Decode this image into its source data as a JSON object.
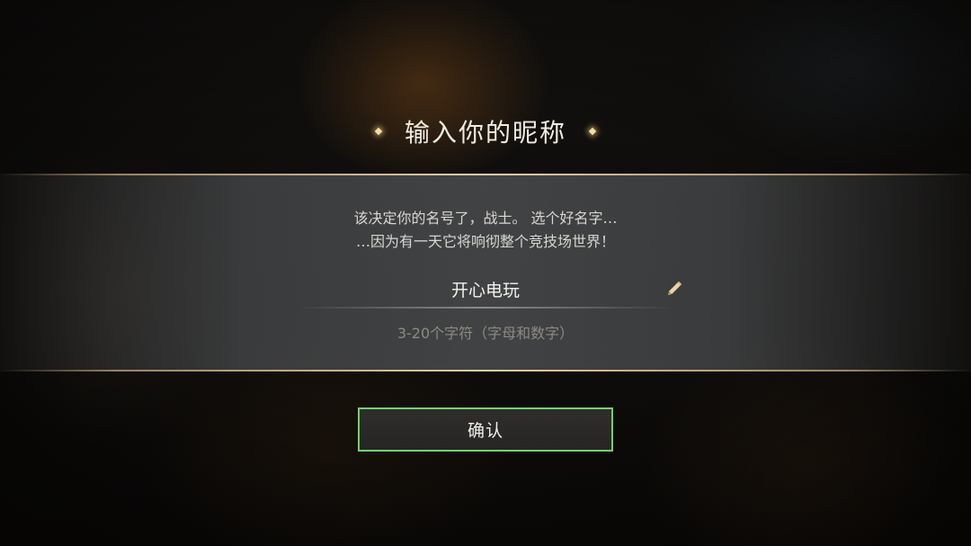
{
  "dialog": {
    "title": "输入你的昵称",
    "description_line1": "该决定你的名号了，战士。 选个好名字…",
    "description_line2": "…因为有一天它将响彻整个竞技场世界！",
    "name_input": {
      "value": "开心电玩"
    },
    "hint": "3-20个字符（字母和数字）",
    "confirm_label": "确认"
  },
  "icons": {
    "title_left": "sparkle-icon",
    "title_right": "sparkle-icon",
    "edit": "pencil-icon"
  },
  "colors": {
    "accent_gold": "#e6cd9f",
    "confirm_border": "#74d16c",
    "panel": "#4a4c4e"
  }
}
